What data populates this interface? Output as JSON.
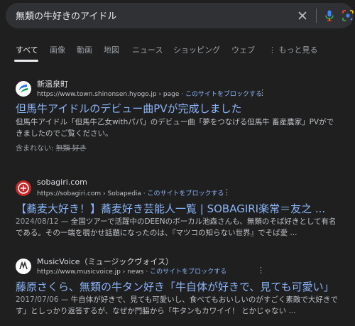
{
  "search": {
    "query": "無類の牛好きのアイドル"
  },
  "tabs": [
    {
      "label": "すべて"
    },
    {
      "label": "画像"
    },
    {
      "label": "動画"
    },
    {
      "label": "地図"
    },
    {
      "label": "ニュース"
    },
    {
      "label": "ショッピング"
    },
    {
      "label": "ウェブ"
    },
    {
      "label": "⋮ もっと見る"
    }
  ],
  "results": [
    {
      "site_name": "新温泉町",
      "url": "https://www.town.shinonsen.hyogo.jp › page",
      "block_label": "このサイトをブロックする",
      "title": "但馬牛アイドルのデビュー曲PVが完成しました",
      "snippet_l1": "但馬牛アイドル「但馬牛乙女withパパ」のデビュー曲「夢をつなげる但馬牛 畜産農家」PVがで",
      "snippet_l2": "きましたのでご覧ください。",
      "missing_label": "含まれない:",
      "missing_terms": "無類 好き"
    },
    {
      "site_name": "sobagiri.com",
      "url": "https://sobagiri.com › Sobapedia",
      "block_label": "このサイトをブロックする",
      "title": "【蕎麦大好き！】蕎麦好き芸能人一覧 | SOBAGIRI楽常＝友之 ...",
      "date": "2024/08/12",
      "snippet_l1": " — 全国ツアーで活躍中のDEENのボーカル池森さんも、無類のそば好きとして有名",
      "snippet_l2": "である。その一端を覗かせ話題になったのは、『マツコの知らない世界』でそば愛 ..."
    },
    {
      "site_name": "MusicVoice（ミュージックヴォイス）",
      "url": "https://www.musicvoice.jp › news",
      "block_label": "このサイトをブロックする",
      "title": "藤原さくら、無類の牛タン好き「牛自体が好きで、見ても可愛い」",
      "date": "2017/07/06",
      "snippet_l1": " — 牛自体が好きで、見ても可愛いし、食べてもおいしいのがすごく素敵で大好きで",
      "snippet_l2": "す」としっかり返答するが、なぜか門脇から「牛タンもカワイイ！ とかじゃない ..."
    }
  ],
  "colors": {
    "background": "#1f1f1f",
    "link": "#8ab4f8",
    "text": "#bdc1c6"
  }
}
